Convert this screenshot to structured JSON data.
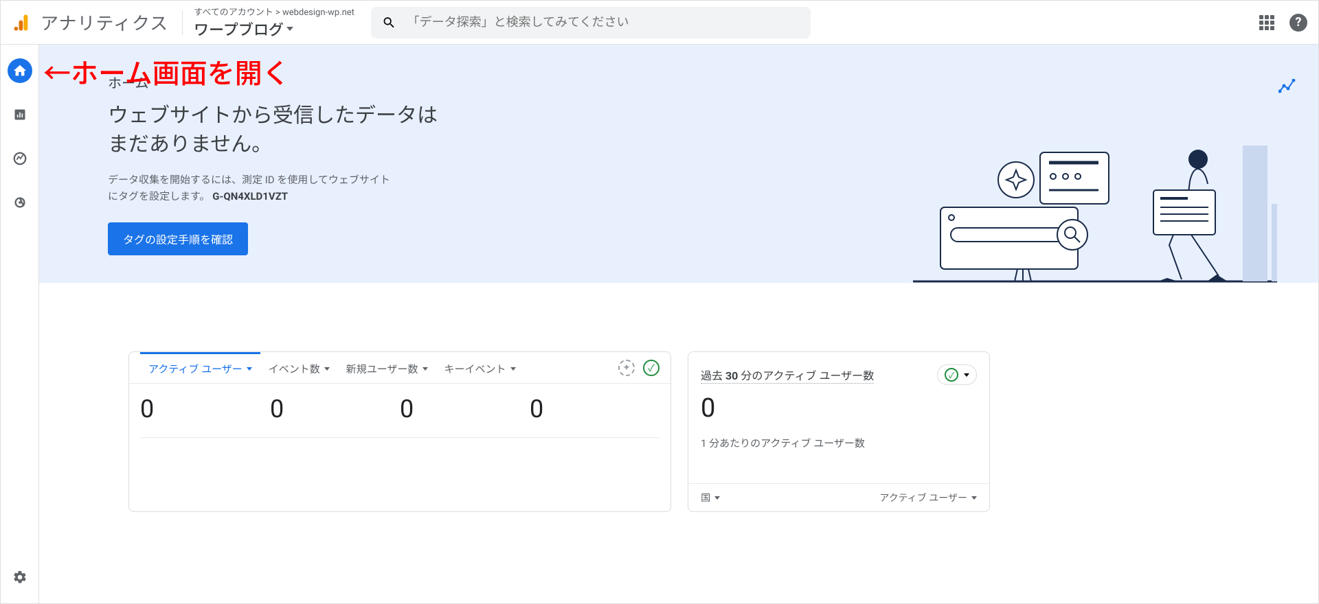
{
  "header": {
    "product_name": "アナリティクス",
    "account_path": "すべてのアカウント > webdesign-wp.net",
    "property_name": "ワープブログ",
    "search_placeholder": "「データ探索」と検索してみてください"
  },
  "annotation": {
    "label": "←ホーム画面を開く"
  },
  "hero": {
    "section_label": "ホーム",
    "heading_line1": "ウェブサイトから受信したデータは",
    "heading_line2": "まだありません。",
    "desc": "データ収集を開始するには、測定 ID を使用してウェブサイトにタグを設定します。",
    "measurement_id": "G-QN4XLD1VZT",
    "button_label": "タグの設定手順を確認"
  },
  "card_a": {
    "tabs": [
      {
        "label": "アクティブ ユーザー",
        "value": "0",
        "active": true
      },
      {
        "label": "イベント数",
        "value": "0",
        "active": false
      },
      {
        "label": "新規ユーザー数",
        "value": "0",
        "active": false
      },
      {
        "label": "キーイベント",
        "value": "0",
        "active": false
      }
    ]
  },
  "card_b": {
    "title_prefix": "過去 ",
    "title_bold": "30",
    "title_suffix": " 分のアクティブ ユーザー数",
    "value": "0",
    "subtitle": "1 分あたりのアクティブ ユーザー数",
    "drop_left": "国",
    "drop_right": "アクティブ ユーザー"
  }
}
